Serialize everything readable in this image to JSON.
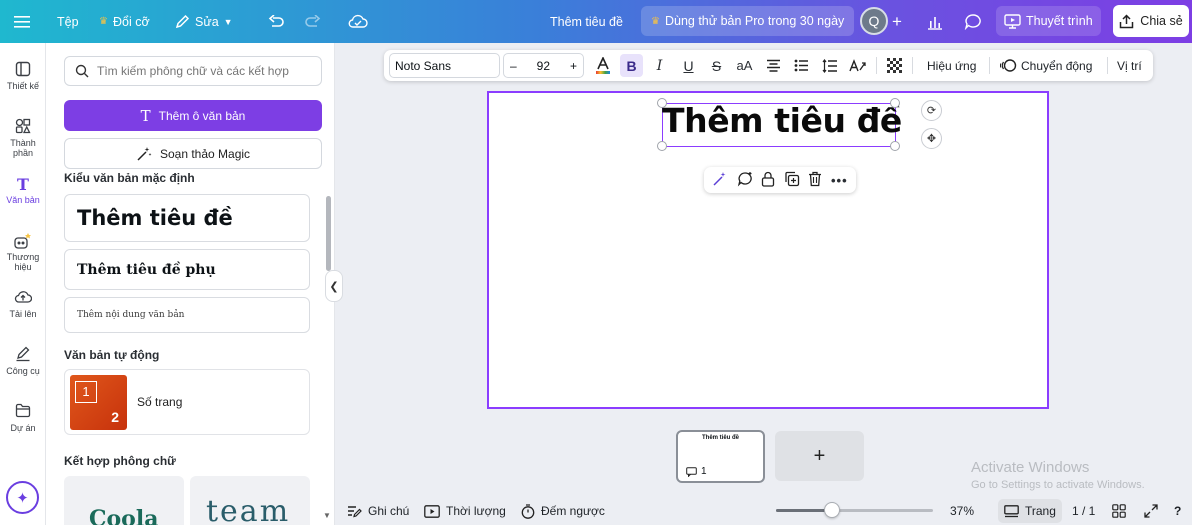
{
  "topbar": {
    "file": "Tệp",
    "resize": "Đổi cỡ",
    "edit": "Sửa",
    "doc_title": "Thêm tiêu đề",
    "pro_trial": "Dùng thử bản Pro trong 30 ngày",
    "avatar_initial": "Q",
    "present": "Thuyết trình",
    "share": "Chia sẻ"
  },
  "rail": {
    "items": [
      {
        "label": "Thiết kế",
        "icon": "layout-icon"
      },
      {
        "label": "Thành phần",
        "icon": "elements-icon"
      },
      {
        "label": "Văn bản",
        "icon": "text-icon"
      },
      {
        "label": "Thương hiệu",
        "icon": "brand-icon"
      },
      {
        "label": "Tải lên",
        "icon": "upload-icon"
      },
      {
        "label": "Công cụ",
        "icon": "draw-icon"
      },
      {
        "label": "Dự án",
        "icon": "folder-icon"
      }
    ]
  },
  "panel": {
    "search_placeholder": "Tìm kiếm phông chữ và các kết hợp",
    "add_textbox": "Thêm ô văn bản",
    "magic_write": "Soạn thảo Magic",
    "default_styles_title": "Kiểu văn bản mặc định",
    "heading": "Thêm tiêu đề",
    "subheading": "Thêm tiêu đề phụ",
    "body": "Thêm nội dung văn bản",
    "dynamic_title": "Văn bản tự động",
    "page_number": "Số trang",
    "page_thumb_a": "1",
    "page_thumb_b": "2",
    "combos_title": "Kết hợp phông chữ",
    "combo_a": "Coola",
    "combo_b": "team"
  },
  "text_toolbar": {
    "font": "Noto Sans",
    "size": "92",
    "minus": "–",
    "plus": "+",
    "effects": "Hiệu ứng",
    "animate": "Chuyển động",
    "position": "Vị trí"
  },
  "canvas": {
    "heading": "Thêm tiêu đề"
  },
  "pages": {
    "thumb_title": "Thêm tiêu đề",
    "thumb_comments": "1",
    "add": "+"
  },
  "bottombar": {
    "notes": "Ghi chú",
    "duration": "Thời lượng",
    "timer": "Đếm ngược",
    "zoom": "37%",
    "zoom_fraction": 0.37,
    "pages_btn": "Trang",
    "page_count": "1 / 1"
  },
  "watermark": {
    "line1": "Activate Windows",
    "line2": "Go to Settings to activate Windows."
  },
  "colors": {
    "accent": "#7d3ee4",
    "selection": "#8b3dff"
  }
}
